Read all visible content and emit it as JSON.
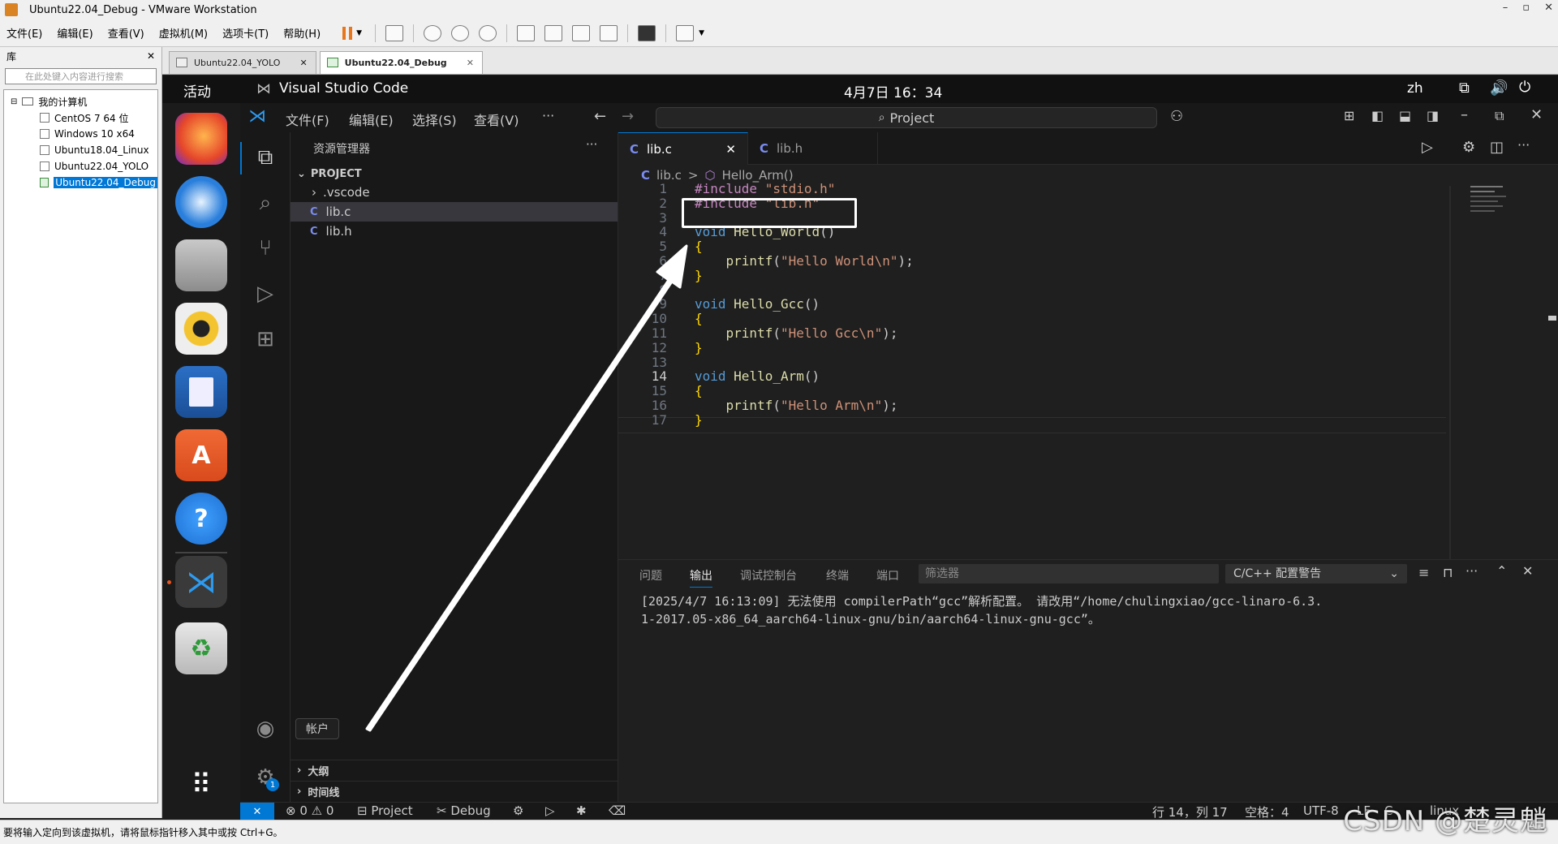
{
  "vmware": {
    "title": "Ubuntu22.04_Debug - VMware Workstation",
    "window_controls": [
      "–",
      "▫",
      "✕"
    ],
    "menu": [
      "文件(E)",
      "编辑(E)",
      "查看(V)",
      "虚拟机(M)",
      "选项卡(T)",
      "帮助(H)"
    ],
    "library": {
      "title": "库",
      "close": "✕",
      "search_placeholder": "在此处键入内容进行搜索",
      "root": "我的计算机",
      "vms": [
        "CentOS 7 64 位",
        "Windows 10 x64",
        "Ubuntu18.04_Linux",
        "Ubuntu22.04_YOLO",
        "Ubuntu22.04_Debug"
      ]
    },
    "tabs": [
      {
        "label": "Ubuntu22.04_YOLO",
        "active": false
      },
      {
        "label": "Ubuntu22.04_Debug",
        "active": true
      }
    ],
    "status": "要将输入定向到该虚拟机，请将鼠标指针移入其中或按 Ctrl+G。"
  },
  "ubuntu": {
    "activities": "活动",
    "app_name": "Visual Studio Code",
    "clock": "4月7日 16：34",
    "lang": "zh"
  },
  "vscode": {
    "menu": [
      "文件(F)",
      "编辑(E)",
      "选择(S)",
      "查看(V)",
      "···"
    ],
    "search": "Project",
    "explorer": {
      "title": "资源管理器",
      "more": "···",
      "root": "PROJECT",
      "items": [
        {
          "name": ".vscode",
          "type": "folder"
        },
        {
          "name": "lib.c",
          "type": "c",
          "selected": true
        },
        {
          "name": "lib.h",
          "type": "c"
        }
      ],
      "outline": "大纲",
      "timeline": "时间线",
      "account_tooltip": "帐户",
      "settings_badge": "1"
    },
    "tabs": [
      {
        "label": "lib.c",
        "active": true,
        "close": "✕"
      },
      {
        "label": "lib.h",
        "active": false
      }
    ],
    "breadcrumb": [
      "lib.c",
      ">",
      "Hello_Arm()"
    ],
    "code_lines": [
      {
        "n": "1",
        "text": "#include \"stdio.h\""
      },
      {
        "n": "2",
        "text": "#include \"lib.h\""
      },
      {
        "n": "3",
        "text": ""
      },
      {
        "n": "4",
        "text": "void Hello_World()"
      },
      {
        "n": "5",
        "text": "{"
      },
      {
        "n": "6",
        "text": "    printf(\"Hello World\\n\");"
      },
      {
        "n": "7",
        "text": "}"
      },
      {
        "n": "8",
        "text": ""
      },
      {
        "n": "9",
        "text": "void Hello_Gcc()"
      },
      {
        "n": "10",
        "text": "{"
      },
      {
        "n": "11",
        "text": "    printf(\"Hello Gcc\\n\");"
      },
      {
        "n": "12",
        "text": "}"
      },
      {
        "n": "13",
        "text": ""
      },
      {
        "n": "14",
        "text": "void Hello_Arm()"
      },
      {
        "n": "15",
        "text": "{"
      },
      {
        "n": "16",
        "text": "    printf(\"Hello Arm\\n\");"
      },
      {
        "n": "17",
        "text": "}"
      }
    ],
    "panel": {
      "tabs": [
        "问题",
        "输出",
        "调试控制台",
        "终端",
        "端口"
      ],
      "active_tab": "输出",
      "filter_placeholder": "筛选器",
      "channel": "C/C++ 配置警告",
      "output": [
        "[2025/4/7 16:13:09] 无法使用 compilerPath“gcc”解析配置。 请改用“/home/chulingxiao/gcc-linaro-6.3.",
        "1-2017.05-x86_64_aarch64-linux-gnu/bin/aarch64-linux-gnu-gcc”。"
      ]
    },
    "status": {
      "remote": "✕",
      "errors": "0",
      "warnings": "0",
      "project": "Project",
      "debug": "Debug",
      "position": "行 14，列 17",
      "spaces": "空格：4",
      "encoding": "UTF-8",
      "eol": "LF",
      "lang": "C",
      "platform": "linux"
    }
  },
  "watermark": "CSDN @楚灵魈",
  "colors": {
    "accent": "#0078d4",
    "keyword": "#569cd6",
    "function": "#dcdcaa",
    "string": "#ce9178",
    "preproc": "#c586c0"
  }
}
